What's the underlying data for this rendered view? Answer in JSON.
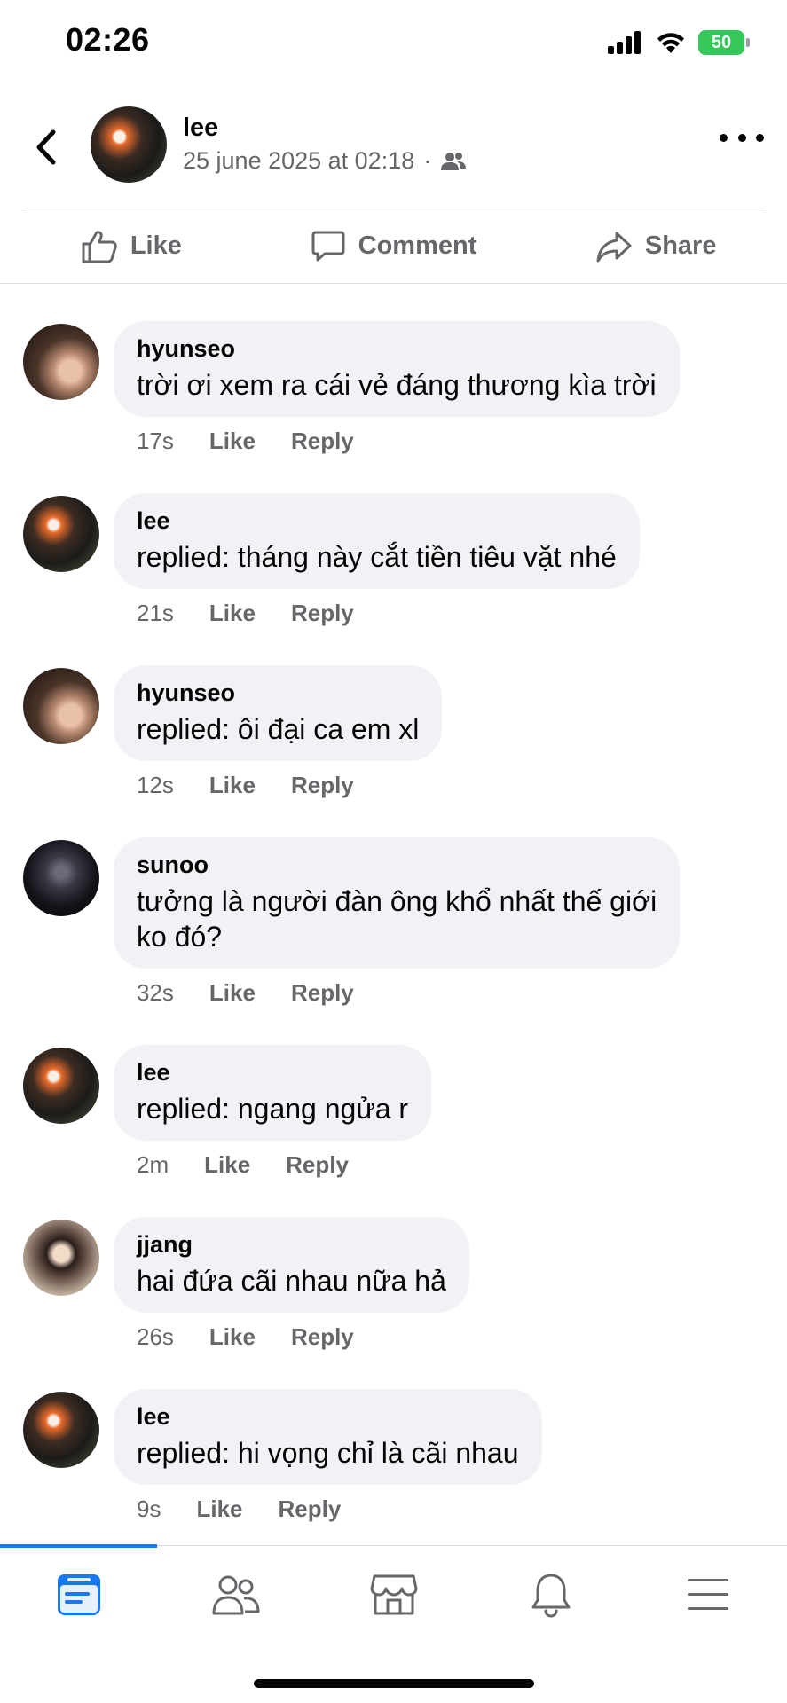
{
  "status_bar": {
    "time": "02:26",
    "battery": "50",
    "icons": [
      "signal-icon",
      "wifi-icon",
      "battery-icon"
    ]
  },
  "post": {
    "author": "lee",
    "date": "25 june 2025 at 02:18",
    "separator": "·",
    "audience_icon": "friends-icon"
  },
  "actions": {
    "like": "Like",
    "comment": "Comment",
    "share": "Share"
  },
  "comments": [
    {
      "name": "hyunseo",
      "text": [
        "trời ơi xem ra cái vẻ đáng thương kìa trời"
      ],
      "time": "17s",
      "like": "Like",
      "reply": "Reply"
    },
    {
      "name": "lee",
      "text": [
        "replied: tháng này cắt tiền tiêu vặt nhé"
      ],
      "time": "21s",
      "like": "Like",
      "reply": "Reply"
    },
    {
      "name": "hyunseo",
      "text": [
        "replied: ôi đại ca em xl"
      ],
      "time": "12s",
      "like": "Like",
      "reply": "Reply"
    },
    {
      "name": "sunoo",
      "text": [
        "tưởng là người đàn ông khổ nhất thế giới",
        "ko đó?"
      ],
      "time": "32s",
      "like": "Like",
      "reply": "Reply"
    },
    {
      "name": "lee",
      "text": [
        "replied: ngang ngửa r"
      ],
      "time": "2m",
      "like": "Like",
      "reply": "Reply"
    },
    {
      "name": "jjang",
      "text": [
        "hai đứa cãi nhau nữa hả"
      ],
      "time": "26s",
      "like": "Like",
      "reply": "Reply"
    },
    {
      "name": "lee",
      "text": [
        "replied: hi vọng chỉ là cãi nhau"
      ],
      "time": "9s",
      "like": "Like",
      "reply": "Reply"
    }
  ],
  "tab_bar": {
    "tabs": [
      "feed-icon",
      "friends-icon",
      "marketplace-icon",
      "notifications-icon",
      "menu-icon"
    ],
    "active_color": "#1877f2",
    "inactive_color": "#65676b"
  }
}
